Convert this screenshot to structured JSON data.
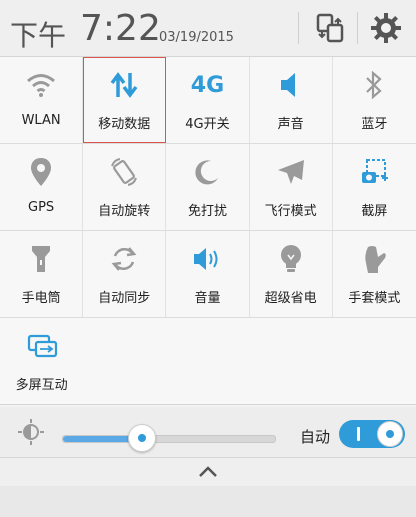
{
  "header": {
    "ampm": "下午",
    "time": "7:22",
    "date": "03/19/2015",
    "swap_icon": "swap-icon",
    "settings_icon": "gear-icon"
  },
  "tiles": [
    [
      {
        "label": "WLAN",
        "icon": "wifi-icon",
        "active": false
      },
      {
        "label": "移动数据",
        "icon": "mobile-data-icon",
        "active": true,
        "selected": true
      },
      {
        "label": "4G开关",
        "icon": "4g-icon",
        "active": true,
        "icon_text": "4G"
      },
      {
        "label": "声音",
        "icon": "sound-icon",
        "active": true
      },
      {
        "label": "蓝牙",
        "icon": "bluetooth-icon",
        "active": false
      }
    ],
    [
      {
        "label": "GPS",
        "icon": "gps-icon",
        "active": false
      },
      {
        "label": "自动旋转",
        "icon": "auto-rotate-icon",
        "active": false
      },
      {
        "label": "免打扰",
        "icon": "moon-icon",
        "active": false
      },
      {
        "label": "飞行模式",
        "icon": "airplane-icon",
        "active": false
      },
      {
        "label": "截屏",
        "icon": "screenshot-icon",
        "active": true
      }
    ],
    [
      {
        "label": "手电筒",
        "icon": "flashlight-icon",
        "active": false
      },
      {
        "label": "自动同步",
        "icon": "sync-icon",
        "active": false
      },
      {
        "label": "音量",
        "icon": "volume-icon",
        "active": true
      },
      {
        "label": "超级省电",
        "icon": "bulb-icon",
        "active": false
      },
      {
        "label": "手套模式",
        "icon": "glove-icon",
        "active": false
      }
    ],
    [
      {
        "label": "多屏互动",
        "icon": "multiscreen-icon",
        "active": true
      }
    ]
  ],
  "brightness": {
    "level": 0.37,
    "auto_label": "自动",
    "auto_on": true
  },
  "colors": {
    "accent": "#2f9bd8",
    "inactive": "#9a9a9a"
  }
}
